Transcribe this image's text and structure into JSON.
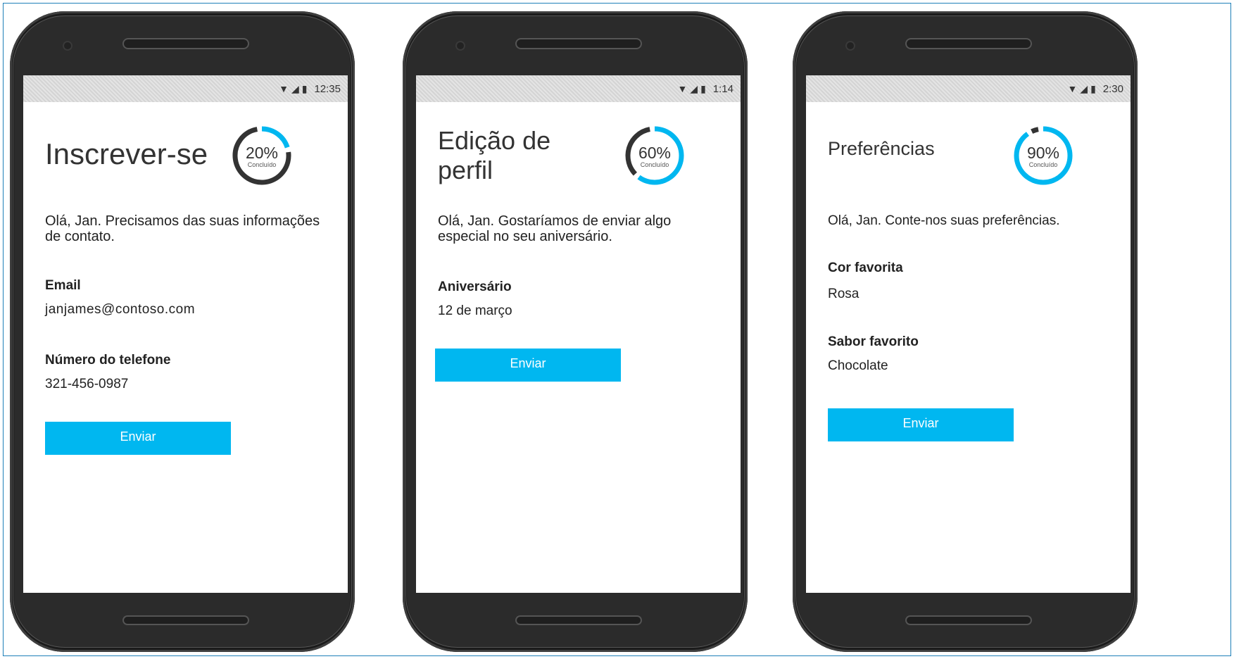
{
  "colors": {
    "accent": "#00b7f0",
    "ring_track": "#333333"
  },
  "phones": [
    {
      "status_time": "12:35",
      "title": "Inscrever-se",
      "progress": {
        "label": "20%",
        "caption": "Concluído",
        "value": 20
      },
      "intro": "Olá, Jan. Precisamos das suas informações de contato.",
      "fields": [
        {
          "label": "Email",
          "value": "janjames@contoso.com"
        },
        {
          "label": "Número do telefone",
          "value": "321-456-0987"
        }
      ],
      "submit_label": "Enviar"
    },
    {
      "status_time": "1:14",
      "title": "Edição de perfil",
      "progress": {
        "label": "60%",
        "caption": "Concluído",
        "value": 60
      },
      "intro": "Olá, Jan. Gostaríamos de enviar algo especial no seu aniversário.",
      "fields": [
        {
          "label": "Aniversário",
          "value": "12 de março"
        }
      ],
      "submit_label": "Enviar"
    },
    {
      "status_time": "2:30",
      "title": "Preferências",
      "progress": {
        "label": "90%",
        "caption": "Concluído",
        "value": 90
      },
      "intro": "Olá, Jan. Conte-nos suas preferências.",
      "fields": [
        {
          "label": "Cor favorita",
          "value": "Rosa"
        },
        {
          "label": "Sabor favorito",
          "value": "Chocolate"
        }
      ],
      "submit_label": "Enviar"
    }
  ]
}
